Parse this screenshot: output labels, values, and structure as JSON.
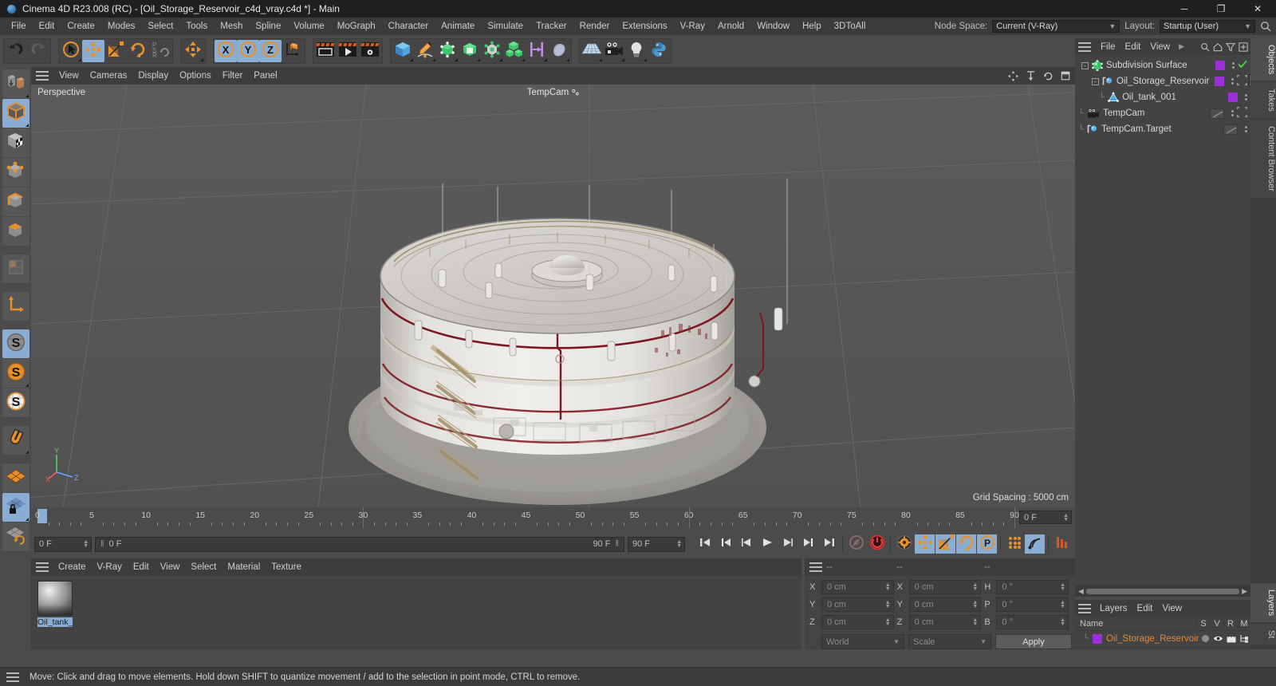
{
  "window": {
    "title": "Cinema 4D R23.008 (RC) - [Oil_Storage_Reservoir_c4d_vray.c4d *] - Main",
    "minimize": "─",
    "maximize": "❐",
    "close": "✕"
  },
  "menubar": {
    "items": [
      "File",
      "Edit",
      "Create",
      "Modes",
      "Select",
      "Tools",
      "Mesh",
      "Spline",
      "Volume",
      "MoGraph",
      "Character",
      "Animate",
      "Simulate",
      "Tracker",
      "Render",
      "Extensions",
      "V-Ray",
      "Arnold",
      "Window",
      "Help",
      "3DToAll"
    ],
    "node_space_label": "Node Space:",
    "node_space_value": "Current (V-Ray)",
    "layout_label": "Layout:",
    "layout_value": "Startup (User)",
    "search_icon": "search-icon"
  },
  "toolbar": {
    "groups": [
      {
        "name": "history",
        "buttons": [
          {
            "name": "undo-button",
            "icon": "undo-icon",
            "selected": false,
            "corner": false
          },
          {
            "name": "redo-button",
            "icon": "redo-icon",
            "selected": false,
            "corner": false
          }
        ]
      },
      {
        "name": "transform",
        "buttons": [
          {
            "name": "live-selection-tool",
            "icon": "cursor-circle-icon",
            "selected": false,
            "corner": true
          },
          {
            "name": "move-tool",
            "icon": "move-arrows-icon",
            "selected": true,
            "corner": false
          },
          {
            "name": "scale-tool",
            "icon": "scale-icon",
            "selected": false,
            "corner": false
          },
          {
            "name": "rotate-tool",
            "icon": "rotate-icon",
            "selected": false,
            "corner": false
          },
          {
            "name": "psr-tool",
            "icon": "psr-icon",
            "selected": false,
            "corner": false
          }
        ]
      },
      {
        "name": "move-group",
        "buttons": [
          {
            "name": "move-mode-button",
            "icon": "move-arrows-icon",
            "selected": false,
            "corner": true
          }
        ]
      },
      {
        "name": "axis-locks",
        "buttons": [
          {
            "name": "lock-x-axis",
            "icon": "x-axis-icon",
            "selected": true,
            "corner": false
          },
          {
            "name": "lock-y-axis",
            "icon": "y-axis-icon",
            "selected": true,
            "corner": false
          },
          {
            "name": "lock-z-axis",
            "icon": "z-axis-icon",
            "selected": true,
            "corner": false
          },
          {
            "name": "world-object-coordinates",
            "icon": "world-axis-icon",
            "selected": false,
            "corner": false
          }
        ]
      },
      {
        "name": "render",
        "buttons": [
          {
            "name": "render-view-button",
            "icon": "render-view-icon",
            "selected": false,
            "corner": false
          },
          {
            "name": "render-to-picture-viewer-button",
            "icon": "render-picture-icon",
            "selected": false,
            "corner": false
          },
          {
            "name": "render-settings-button",
            "icon": "render-settings-icon",
            "selected": false,
            "corner": false
          }
        ]
      },
      {
        "name": "objects",
        "buttons": [
          {
            "name": "add-cube-button",
            "icon": "cube-blue-icon",
            "selected": false,
            "corner": true
          },
          {
            "name": "add-spline-button",
            "icon": "pen-spline-icon",
            "selected": false,
            "corner": true
          },
          {
            "name": "add-generator-button",
            "icon": "generator-green-icon",
            "selected": false,
            "corner": true
          },
          {
            "name": "add-bend-deformer-button",
            "icon": "bend-green-icon",
            "selected": false,
            "corner": true
          },
          {
            "name": "add-effector-button",
            "icon": "effector-icon",
            "selected": false,
            "corner": true
          },
          {
            "name": "add-mograph-button",
            "icon": "mograph-cubes-icon",
            "selected": false,
            "corner": true
          },
          {
            "name": "add-field-button",
            "icon": "field-icon",
            "selected": false,
            "corner": true
          },
          {
            "name": "add-volume-button",
            "icon": "volume-icon",
            "selected": false,
            "corner": true
          }
        ]
      },
      {
        "name": "scene",
        "buttons": [
          {
            "name": "add-floor-button",
            "icon": "floor-grid-icon",
            "selected": false,
            "corner": true
          },
          {
            "name": "add-camera-button",
            "icon": "camera-icon",
            "selected": false,
            "corner": true
          },
          {
            "name": "add-light-button",
            "icon": "light-bulb-icon",
            "selected": false,
            "corner": true
          },
          {
            "name": "script-manager-button",
            "icon": "python-icon",
            "selected": false,
            "corner": false
          }
        ]
      }
    ]
  },
  "left_palette": {
    "items": [
      {
        "name": "make-editable-button",
        "icon": "make-editable-icon",
        "selected": false,
        "corner": true
      },
      {
        "name": "model-mode-button",
        "icon": "cube-solid-icon",
        "selected": true,
        "corner": true
      },
      {
        "name": "texture-mode-button",
        "icon": "cube-checker-icon",
        "selected": false,
        "corner": false
      },
      {
        "name": "points-mode-button",
        "icon": "cube-points-icon",
        "selected": false,
        "corner": false
      },
      {
        "name": "edges-mode-button",
        "icon": "cube-edges-icon",
        "selected": false,
        "corner": false
      },
      {
        "name": "polygons-mode-button",
        "icon": "cube-polygon-icon",
        "selected": false,
        "corner": false
      },
      {
        "name": "spacer",
        "icon": "spacer",
        "selected": false,
        "corner": false
      },
      {
        "name": "uv-mode-button",
        "icon": "uv-grid-icon",
        "selected": false,
        "corner": false
      },
      {
        "name": "spacer",
        "icon": "spacer",
        "selected": false,
        "corner": false
      },
      {
        "name": "axis-mode-button",
        "icon": "axis-l-icon",
        "selected": false,
        "corner": false
      },
      {
        "name": "spacer",
        "icon": "spacer",
        "selected": false,
        "corner": false
      },
      {
        "name": "enable-axis-snap-button",
        "icon": "s-grey-icon",
        "selected": true,
        "corner": false
      },
      {
        "name": "workplane-button",
        "icon": "s-orange-icon",
        "selected": false,
        "corner": true
      },
      {
        "name": "workplane-lock-button",
        "icon": "s-white-icon",
        "selected": false,
        "corner": false
      },
      {
        "name": "spacer",
        "icon": "spacer",
        "selected": false,
        "corner": false
      },
      {
        "name": "snap-magnet-button",
        "icon": "magnet-icon",
        "selected": false,
        "corner": true
      },
      {
        "name": "spacer",
        "icon": "spacer",
        "selected": false,
        "corner": false
      },
      {
        "name": "workplane-grid-button",
        "icon": "grid-orange-icon",
        "selected": false,
        "corner": false
      },
      {
        "name": "workplane-lock-grid-button",
        "icon": "grid-lock-icon",
        "selected": true,
        "corner": true
      },
      {
        "name": "workplane-align-button",
        "icon": "grid-rotate-icon",
        "selected": false,
        "corner": false
      }
    ]
  },
  "viewport": {
    "menu_items": [
      "View",
      "Cameras",
      "Display",
      "Filter",
      "Options",
      "Panel"
    ],
    "menu_items_ordered": [
      "View",
      "Cameras",
      "Display",
      "Options",
      "Filter",
      "Panel"
    ],
    "label": "Perspective",
    "camera_label": "TempCam",
    "grid_spacing": "Grid Spacing : 5000 cm",
    "right_icons": [
      "move-view-icon",
      "zoom-view-icon",
      "rotate-view-icon",
      "maximize-view-icon"
    ],
    "axis": {
      "x": "X",
      "y": "Y",
      "z": "Z"
    },
    "background_color": "#565656",
    "model_description": "Oil storage reservoir tank, white cylindrical tank with stairs and railings"
  },
  "timeline": {
    "ticks": [
      0,
      5,
      10,
      15,
      20,
      25,
      30,
      35,
      40,
      45,
      50,
      55,
      60,
      65,
      70,
      75,
      80,
      85,
      90
    ],
    "current_frame_display": "0 F",
    "playhead_frame": 0,
    "green_markers": [
      30,
      60,
      90
    ]
  },
  "transport": {
    "start_field": "0 F",
    "current_field": "0 F",
    "preview_min": "90 F",
    "end_field": "90 F",
    "buttons": [
      {
        "name": "go-to-start-button",
        "icon": "skip-start-icon",
        "selected": false
      },
      {
        "name": "go-to-previous-key-button",
        "icon": "prev-key-icon",
        "selected": false
      },
      {
        "name": "go-to-previous-frame-button",
        "icon": "step-back-icon",
        "selected": false
      },
      {
        "name": "play-button",
        "icon": "play-icon",
        "selected": false
      },
      {
        "name": "go-to-next-frame-button",
        "icon": "step-forward-icon",
        "selected": false
      },
      {
        "name": "go-to-next-key-button",
        "icon": "next-key-icon",
        "selected": false
      },
      {
        "name": "go-to-end-button",
        "icon": "skip-end-icon",
        "selected": false
      },
      {
        "name": "record-active-objects-button",
        "icon": "record-grey-icon",
        "selected": false
      },
      {
        "name": "autokeying-button",
        "icon": "autokey-red-icon",
        "selected": false
      },
      {
        "name": "keyframe-selection-button",
        "icon": "keyframe-gear-icon",
        "selected": false
      },
      {
        "name": "position-key-button",
        "icon": "move-arrows-icon",
        "selected": true
      },
      {
        "name": "scale-key-button",
        "icon": "scale-icon",
        "selected": true
      },
      {
        "name": "rotation-key-button",
        "icon": "rotate-icon",
        "selected": true
      },
      {
        "name": "parameter-key-button",
        "icon": "param-p-icon",
        "selected": true
      },
      {
        "name": "point-level-animation-button",
        "icon": "pla-dots-icon",
        "selected": false
      },
      {
        "name": "simulate-button",
        "icon": "simulate-icon",
        "selected": true
      },
      {
        "name": "timeline-settings-button",
        "icon": "timeline-bars-icon",
        "selected": false
      }
    ]
  },
  "material_manager": {
    "menu_items": [
      "Create",
      "V-Ray",
      "Edit",
      "View",
      "Select",
      "Material",
      "Texture"
    ],
    "materials": [
      {
        "name": "Oil_tank_",
        "selected": true
      }
    ]
  },
  "coordinates": {
    "header": [
      "--",
      "--",
      "--"
    ],
    "rows": [
      {
        "label1": "X",
        "value1": "0 cm",
        "label2": "X",
        "value2": "0 cm",
        "label3": "H",
        "value3": "0 °"
      },
      {
        "label1": "Y",
        "value1": "0 cm",
        "label2": "Y",
        "value2": "0 cm",
        "label3": "P",
        "value3": "0 °"
      },
      {
        "label1": "Z",
        "value1": "0 cm",
        "label2": "Z",
        "value2": "0 cm",
        "label3": "B",
        "value3": "0 °"
      }
    ],
    "system_select": "World",
    "mode_select": "Scale",
    "apply_button": "Apply"
  },
  "object_manager": {
    "menu_items": [
      "File",
      "Edit",
      "View"
    ],
    "tools": [
      "search-icon",
      "home-icon",
      "filter-icon",
      "add-icon"
    ],
    "rows": [
      {
        "name": "Subdivision Surface",
        "indent": 0,
        "icon": "subdivision-surface-icon",
        "swatch": "#9b30d9",
        "expander": "-",
        "check": true,
        "tags": []
      },
      {
        "name": "Oil_Storage_Reservoir",
        "indent": 1,
        "icon": "null-object-icon",
        "swatch": "#9b30d9",
        "expander": "-",
        "check": false,
        "tags": [
          "material-tag",
          "texture-tag"
        ]
      },
      {
        "name": "Oil_tank_001",
        "indent": 2,
        "icon": "polygon-object-icon",
        "swatch": "#9b30d9",
        "expander": "",
        "check": false,
        "tags": []
      },
      {
        "name": "TempCam",
        "indent": 0,
        "icon": "camera-object-icon",
        "swatch": "",
        "expander": "",
        "check": false,
        "tags": [
          "camera-tag"
        ]
      },
      {
        "name": "TempCam.Target",
        "indent": 0,
        "icon": "null-object-icon",
        "swatch": "",
        "expander": "",
        "check": false,
        "tags": []
      }
    ]
  },
  "layers": {
    "menu_items": [
      "Layers",
      "Edit",
      "View"
    ],
    "columns": [
      "Name",
      "S",
      "V",
      "R",
      "M"
    ],
    "rows": [
      {
        "name": "Oil_Storage_Reservoir",
        "swatch": "#9b30d9"
      }
    ]
  },
  "vertical_tabs_top": [
    "Objects",
    "Takes",
    "Content Browser"
  ],
  "vertical_tabs_bottom": [
    "Layers",
    "St"
  ],
  "statusbar": {
    "message": "Move: Click and drag to move elements. Hold down SHIFT to quantize movement / add to the selection in point mode, CTRL to remove."
  }
}
